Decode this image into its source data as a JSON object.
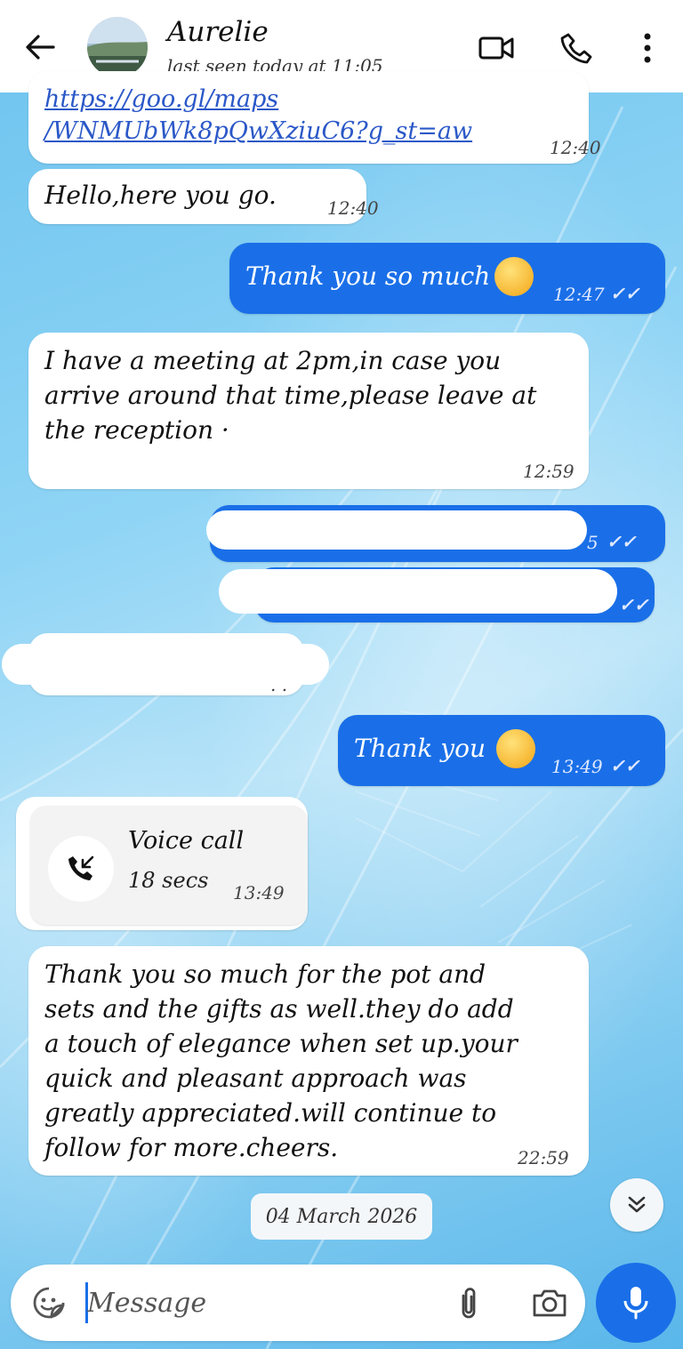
{
  "header": {
    "contact_name": "Aurelie",
    "status": "last seen today at 11:05",
    "icons": [
      "back-arrow-icon",
      "video-camera-icon",
      "phone-icon",
      "more-vertical-icon"
    ]
  },
  "messages": {
    "m1": {
      "link": "https://goo.gl/maps\n/WNMUbWk8pQwXziuC6?g_st=aw",
      "time": "12:40"
    },
    "m2": {
      "text": "Hello,here you go.",
      "time": "12:40"
    },
    "m3": {
      "text": "Thank you so much",
      "time": "12:47",
      "ticks": "✓✓"
    },
    "m4": {
      "text": "I have a meeting at 2pm,in case you\narrive around that time,please leave at\nthe reception ·",
      "time": "12:59"
    },
    "m5": {
      "time_partial": "5",
      "ticks": "✓✓"
    },
    "m6": {
      "ticks": "✓✓"
    },
    "m7": {
      "text": ". ."
    },
    "m8": {
      "text": "Thank you",
      "time": "13:49",
      "ticks": "✓✓"
    },
    "m10": {
      "text": "Thank you so much for the pot and\nsets and the gifts as well.they do add\na touch of elegance when set up.your\nquick and pleasant approach was\ngreatly appreciated.will continue to\nfollow for more.cheers.",
      "time": "22:59"
    }
  },
  "voice_call": {
    "title": "Voice call",
    "duration": "18 secs",
    "time": "13:49"
  },
  "date_chip": "04 March 2026",
  "composer": {
    "placeholder": "Message"
  },
  "colors": {
    "outgoing_bubble": "#1a6fe8",
    "incoming_bubble": "#ffffff",
    "accent": "#1a6fe8"
  }
}
